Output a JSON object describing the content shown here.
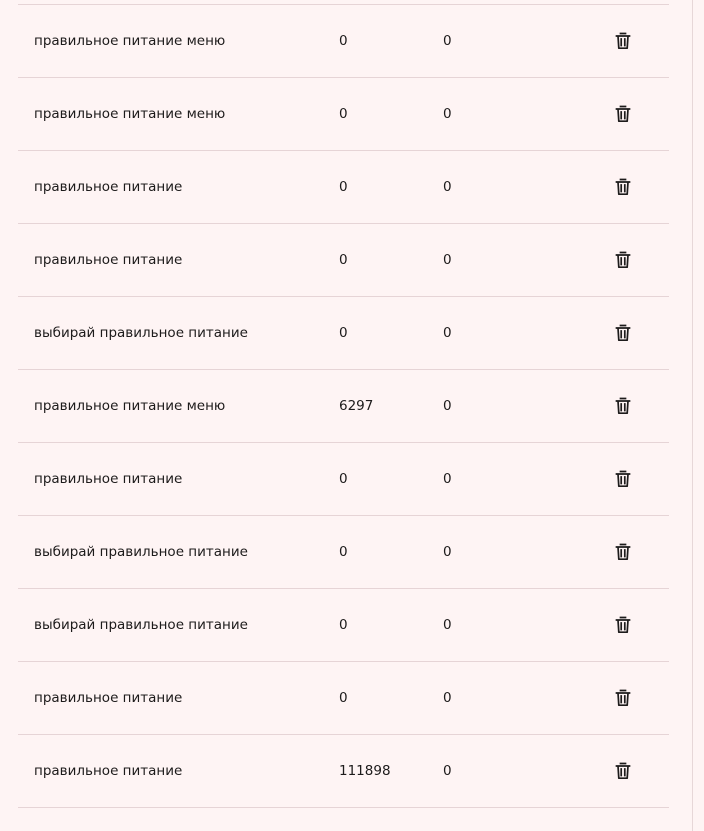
{
  "table": {
    "rows": [
      {
        "query": "правильное питание меню",
        "value1": "0",
        "value2": "0",
        "action_icon": "trash-icon"
      },
      {
        "query": "правильное питание меню",
        "value1": "0",
        "value2": "0",
        "action_icon": "trash-icon"
      },
      {
        "query": "правильное питание",
        "value1": "0",
        "value2": "0",
        "action_icon": "trash-icon"
      },
      {
        "query": "правильное питание",
        "value1": "0",
        "value2": "0",
        "action_icon": "trash-icon"
      },
      {
        "query": "выбирай правильное питание",
        "value1": "0",
        "value2": "0",
        "action_icon": "trash-icon"
      },
      {
        "query": "правильное питание меню",
        "value1": "6297",
        "value2": "0",
        "action_icon": "trash-icon"
      },
      {
        "query": "правильное питание",
        "value1": "0",
        "value2": "0",
        "action_icon": "trash-icon"
      },
      {
        "query": "выбирай правильное питание",
        "value1": "0",
        "value2": "0",
        "action_icon": "trash-icon"
      },
      {
        "query": "выбирай правильное питание",
        "value1": "0",
        "value2": "0",
        "action_icon": "trash-icon"
      },
      {
        "query": "правильное питание",
        "value1": "0",
        "value2": "0",
        "action_icon": "trash-icon"
      },
      {
        "query": "правильное питание",
        "value1": "111898",
        "value2": "0",
        "action_icon": "trash-icon"
      }
    ]
  },
  "colors": {
    "background": "#fef4f4",
    "divider": "#e6d4d6",
    "text": "#1d1b1b"
  }
}
